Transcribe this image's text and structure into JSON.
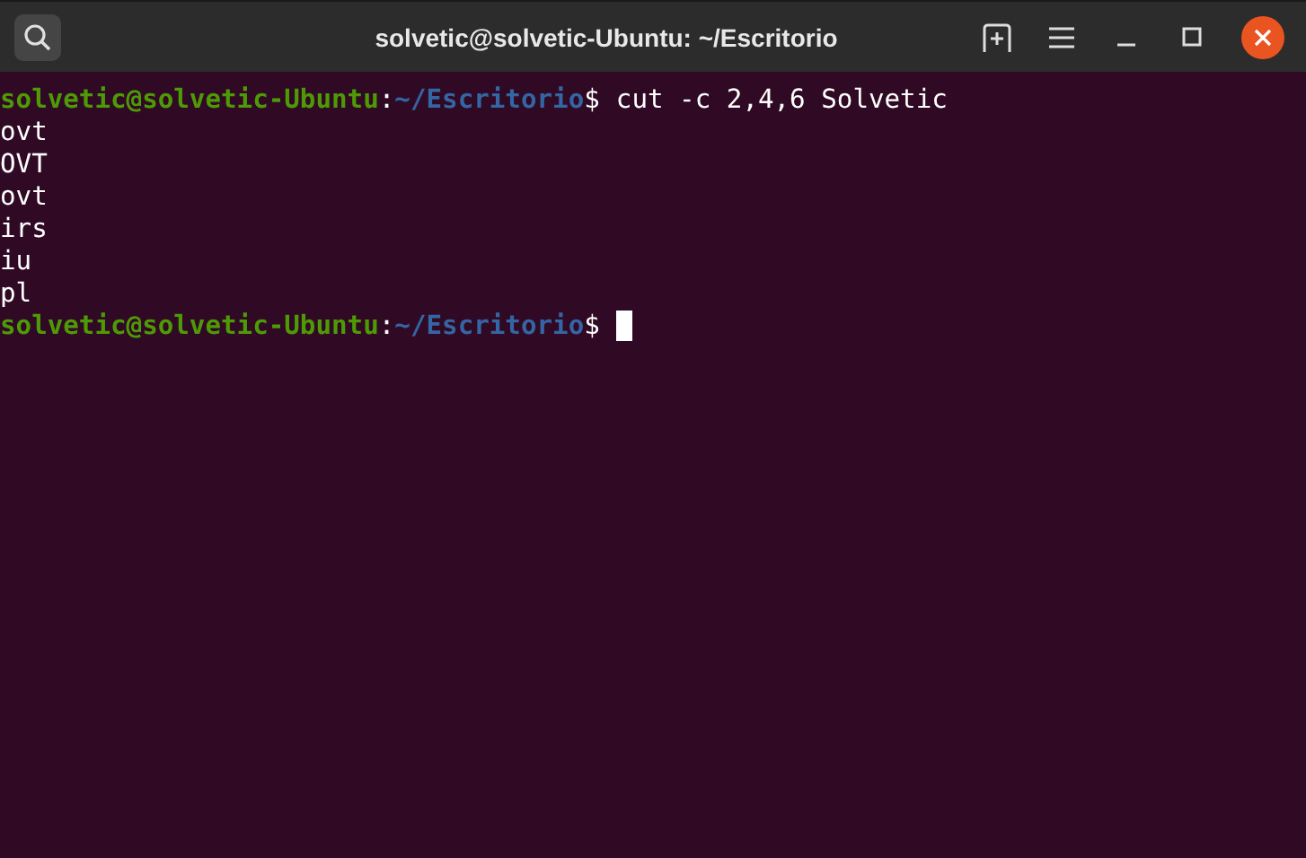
{
  "window": {
    "title": "solvetic@solvetic-Ubuntu: ~/Escritorio"
  },
  "terminal": {
    "lines": [
      {
        "kind": "prompt",
        "user_host": "solvetic@solvetic-Ubuntu",
        "separator": ":",
        "path": "~/Escritorio",
        "symbol": "$",
        "command": "cut -c 2,4,6 Solvetic"
      },
      {
        "kind": "output",
        "text": "ovt"
      },
      {
        "kind": "output",
        "text": "OVT"
      },
      {
        "kind": "output",
        "text": "ovt"
      },
      {
        "kind": "output",
        "text": "irs"
      },
      {
        "kind": "output",
        "text": "iu"
      },
      {
        "kind": "output",
        "text": "pl"
      },
      {
        "kind": "prompt",
        "user_host": "solvetic@solvetic-Ubuntu",
        "separator": ":",
        "path": "~/Escritorio",
        "symbol": "$",
        "cursor": true
      }
    ]
  }
}
